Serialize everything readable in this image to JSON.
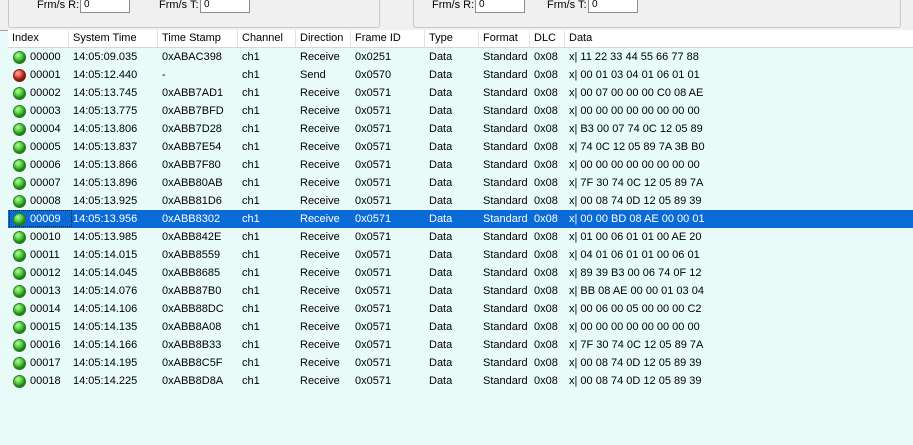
{
  "stats": {
    "left": {
      "rx_label": "Frm/s R:",
      "rx_value": "0",
      "tx_label": "Frm/s T:",
      "tx_value": "0"
    },
    "right": {
      "rx_label": "Frm/s R:",
      "rx_value": "0",
      "tx_label": "Frm/s T:",
      "tx_value": "0"
    }
  },
  "columns": [
    "Index",
    "System Time",
    "Time Stamp",
    "Channel",
    "Direction",
    "Frame ID",
    "Type",
    "Format",
    "DLC",
    "Data"
  ],
  "status_colors": {
    "ok": "#2fbf24",
    "error": "#d62a20",
    "selected_row": "#0a6bd6"
  },
  "selected_index": "00009",
  "rows": [
    {
      "status": "green",
      "index": "00000",
      "system_time": "14:05:09.035",
      "time_stamp": "0xABAC398",
      "channel": "ch1",
      "direction": "Receive",
      "frame_id": "0x0251",
      "type": "Data",
      "format": "Standard",
      "dlc": "0x08",
      "data": "x| 11 22 33 44 55 66 77 88"
    },
    {
      "status": "red",
      "index": "00001",
      "system_time": "14:05:12.440",
      "time_stamp": "-",
      "channel": "ch1",
      "direction": "Send",
      "frame_id": "0x0570",
      "type": "Data",
      "format": "Standard",
      "dlc": "0x08",
      "data": "x| 00 01 03 04 01 06 01 01"
    },
    {
      "status": "green",
      "index": "00002",
      "system_time": "14:05:13.745",
      "time_stamp": "0xABB7AD1",
      "channel": "ch1",
      "direction": "Receive",
      "frame_id": "0x0571",
      "type": "Data",
      "format": "Standard",
      "dlc": "0x08",
      "data": "x| 00 07 00 00 00 C0 08 AE"
    },
    {
      "status": "green",
      "index": "00003",
      "system_time": "14:05:13.775",
      "time_stamp": "0xABB7BFD",
      "channel": "ch1",
      "direction": "Receive",
      "frame_id": "0x0571",
      "type": "Data",
      "format": "Standard",
      "dlc": "0x08",
      "data": "x| 00 00 00 00 00 00 00 00"
    },
    {
      "status": "green",
      "index": "00004",
      "system_time": "14:05:13.806",
      "time_stamp": "0xABB7D28",
      "channel": "ch1",
      "direction": "Receive",
      "frame_id": "0x0571",
      "type": "Data",
      "format": "Standard",
      "dlc": "0x08",
      "data": "x| B3 00 07 74 0C 12 05 89"
    },
    {
      "status": "green",
      "index": "00005",
      "system_time": "14:05:13.837",
      "time_stamp": "0xABB7E54",
      "channel": "ch1",
      "direction": "Receive",
      "frame_id": "0x0571",
      "type": "Data",
      "format": "Standard",
      "dlc": "0x08",
      "data": "x| 74 0C 12 05 89 7A 3B B0"
    },
    {
      "status": "green",
      "index": "00006",
      "system_time": "14:05:13.866",
      "time_stamp": "0xABB7F80",
      "channel": "ch1",
      "direction": "Receive",
      "frame_id": "0x0571",
      "type": "Data",
      "format": "Standard",
      "dlc": "0x08",
      "data": "x| 00 00 00 00 00 00 00 00"
    },
    {
      "status": "green",
      "index": "00007",
      "system_time": "14:05:13.896",
      "time_stamp": "0xABB80AB",
      "channel": "ch1",
      "direction": "Receive",
      "frame_id": "0x0571",
      "type": "Data",
      "format": "Standard",
      "dlc": "0x08",
      "data": "x| 7F 30 74 0C 12 05 89 7A"
    },
    {
      "status": "green",
      "index": "00008",
      "system_time": "14:05:13.925",
      "time_stamp": "0xABB81D6",
      "channel": "ch1",
      "direction": "Receive",
      "frame_id": "0x0571",
      "type": "Data",
      "format": "Standard",
      "dlc": "0x08",
      "data": "x| 00 08 74 0D 12 05 89 39"
    },
    {
      "status": "green",
      "index": "00009",
      "system_time": "14:05:13.956",
      "time_stamp": "0xABB8302",
      "channel": "ch1",
      "direction": "Receive",
      "frame_id": "0x0571",
      "type": "Data",
      "format": "Standard",
      "dlc": "0x08",
      "data": "x| 00 00 BD 08 AE 00 00 01"
    },
    {
      "status": "green",
      "index": "00010",
      "system_time": "14:05:13.985",
      "time_stamp": "0xABB842E",
      "channel": "ch1",
      "direction": "Receive",
      "frame_id": "0x0571",
      "type": "Data",
      "format": "Standard",
      "dlc": "0x08",
      "data": "x| 01 00 06 01 01 00 AE 20"
    },
    {
      "status": "green",
      "index": "00011",
      "system_time": "14:05:14.015",
      "time_stamp": "0xABB8559",
      "channel": "ch1",
      "direction": "Receive",
      "frame_id": "0x0571",
      "type": "Data",
      "format": "Standard",
      "dlc": "0x08",
      "data": "x| 04 01 06 01 01 00 06 01"
    },
    {
      "status": "green",
      "index": "00012",
      "system_time": "14:05:14.045",
      "time_stamp": "0xABB8685",
      "channel": "ch1",
      "direction": "Receive",
      "frame_id": "0x0571",
      "type": "Data",
      "format": "Standard",
      "dlc": "0x08",
      "data": "x| 89 39 B3 00 06 74 0F 12"
    },
    {
      "status": "green",
      "index": "00013",
      "system_time": "14:05:14.076",
      "time_stamp": "0xABB87B0",
      "channel": "ch1",
      "direction": "Receive",
      "frame_id": "0x0571",
      "type": "Data",
      "format": "Standard",
      "dlc": "0x08",
      "data": "x| BB 08 AE 00 00 01 03 04"
    },
    {
      "status": "green",
      "index": "00014",
      "system_time": "14:05:14.106",
      "time_stamp": "0xABB88DC",
      "channel": "ch1",
      "direction": "Receive",
      "frame_id": "0x0571",
      "type": "Data",
      "format": "Standard",
      "dlc": "0x08",
      "data": "x| 00 06 00 05 00 00 00 C2"
    },
    {
      "status": "green",
      "index": "00015",
      "system_time": "14:05:14.135",
      "time_stamp": "0xABB8A08",
      "channel": "ch1",
      "direction": "Receive",
      "frame_id": "0x0571",
      "type": "Data",
      "format": "Standard",
      "dlc": "0x08",
      "data": "x| 00 00 00 00 00 00 00 00"
    },
    {
      "status": "green",
      "index": "00016",
      "system_time": "14:05:14.166",
      "time_stamp": "0xABB8B33",
      "channel": "ch1",
      "direction": "Receive",
      "frame_id": "0x0571",
      "type": "Data",
      "format": "Standard",
      "dlc": "0x08",
      "data": "x| 7F 30 74 0C 12 05 89 7A"
    },
    {
      "status": "green",
      "index": "00017",
      "system_time": "14:05:14.195",
      "time_stamp": "0xABB8C5F",
      "channel": "ch1",
      "direction": "Receive",
      "frame_id": "0x0571",
      "type": "Data",
      "format": "Standard",
      "dlc": "0x08",
      "data": "x| 00 08 74 0D 12 05 89 39"
    },
    {
      "status": "green",
      "index": "00018",
      "system_time": "14:05:14.225",
      "time_stamp": "0xABB8D8A",
      "channel": "ch1",
      "direction": "Receive",
      "frame_id": "0x0571",
      "type": "Data",
      "format": "Standard",
      "dlc": "0x08",
      "data": "x| 00 08 74 0D 12 05 89 39"
    }
  ]
}
